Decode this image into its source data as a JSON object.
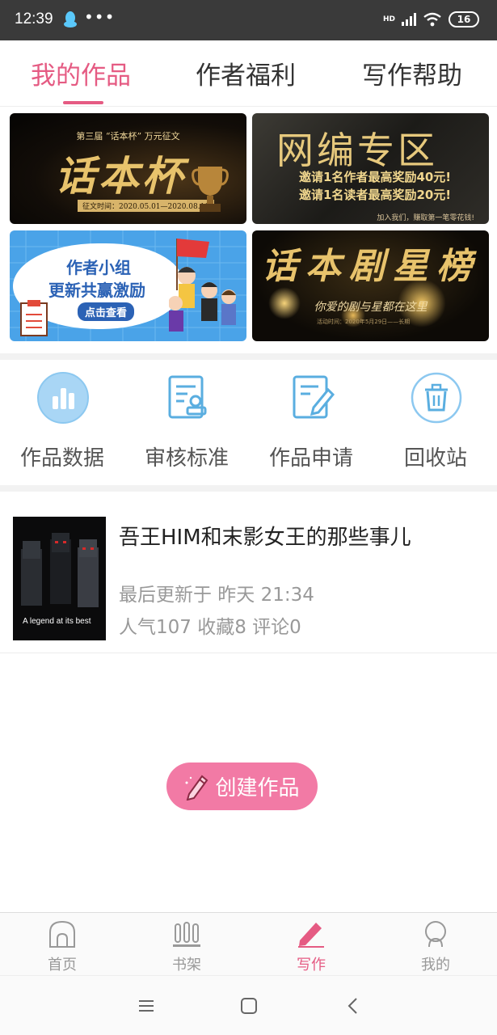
{
  "status_bar": {
    "time": "12:39",
    "dots": "•••",
    "network": "HD",
    "battery": "16"
  },
  "top_tabs": [
    {
      "label": "我的作品",
      "active": true
    },
    {
      "label": "作者福利",
      "active": false
    },
    {
      "label": "写作帮助",
      "active": false
    }
  ],
  "banners": {
    "contest": {
      "subtitle": "第三届 “话本杯” 万元征文",
      "title": "话本杯",
      "dates": "征文时间：2020.05.01—2020.08.10"
    },
    "webnovel": {
      "title": "网编专区",
      "line1": "邀请1名作者最高奖励40元!",
      "line2": "邀请1名读者最高奖励20元!",
      "footer": "加入我们，赚取第一笔零花钱!"
    },
    "author_group": {
      "line1": "作者小组",
      "line2": "更新共赢激励",
      "button": "点击查看"
    },
    "drama_stars": {
      "title": "话本剧星榜",
      "subtitle": "你爱的剧与星都在这里",
      "footer": "活动时间：2020年5月29日——长期"
    }
  },
  "actions": [
    {
      "label": "作品数据",
      "icon": "bar-chart-icon"
    },
    {
      "label": "审核标准",
      "icon": "review-standard-icon"
    },
    {
      "label": "作品申请",
      "icon": "apply-edit-icon"
    },
    {
      "label": "回收站",
      "icon": "trash-icon"
    }
  ],
  "works": [
    {
      "title": "吾王HIM和末影女王的那些事儿",
      "cover_text": "A legend at its best",
      "last_update": "最后更新于 昨天 21:34",
      "stats": "人气107 收藏8 评论0"
    }
  ],
  "create_button": {
    "label": "创建作品"
  },
  "bottom_nav": [
    {
      "label": "首页",
      "icon": "home-icon",
      "active": false
    },
    {
      "label": "书架",
      "icon": "bookshelf-icon",
      "active": false
    },
    {
      "label": "写作",
      "icon": "write-pen-icon",
      "active": true
    },
    {
      "label": "我的",
      "icon": "profile-icon",
      "active": false
    }
  ],
  "colors": {
    "accent": "#e55b83",
    "create_button": "#f27aa5",
    "icon_blue": "#5aaee0",
    "status_bar": "#3a3a3a"
  }
}
